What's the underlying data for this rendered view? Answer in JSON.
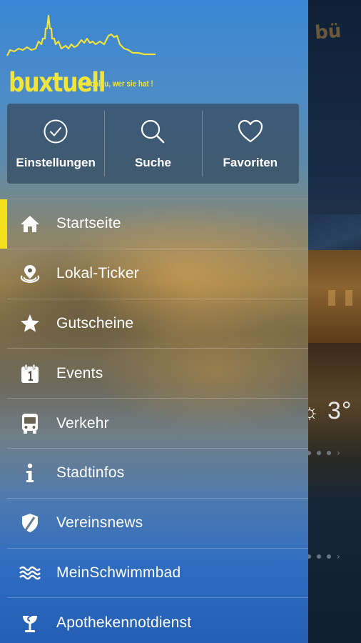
{
  "app": {
    "name": "buxtuell",
    "tagline": "Schlau, wer sie hat !",
    "accent_color": "#f1e43a",
    "active_indicator_color": "#f4e11c"
  },
  "quick_actions": [
    {
      "label": "Einstellungen",
      "icon": "check-circle-icon"
    },
    {
      "label": "Suche",
      "icon": "search-icon"
    },
    {
      "label": "Favoriten",
      "icon": "heart-icon"
    }
  ],
  "menu": {
    "items": [
      {
        "label": "Startseite",
        "icon": "home-icon",
        "active": true
      },
      {
        "label": "Lokal-Ticker",
        "icon": "location-ticker-icon",
        "active": false
      },
      {
        "label": "Gutscheine",
        "icon": "star-icon",
        "active": false
      },
      {
        "label": "Events",
        "icon": "calendar-icon",
        "active": false
      },
      {
        "label": "Verkehr",
        "icon": "bus-icon",
        "active": false
      },
      {
        "label": "Stadtinfos",
        "icon": "info-icon",
        "active": false
      },
      {
        "label": "Vereinsnews",
        "icon": "shield-icon",
        "active": false
      },
      {
        "label": "MeinSchwimmbad",
        "icon": "waves-icon",
        "active": false
      },
      {
        "label": "Apothekennotdienst",
        "icon": "pharmacy-icon",
        "active": false
      }
    ]
  },
  "background": {
    "weather_temp": "3°"
  }
}
